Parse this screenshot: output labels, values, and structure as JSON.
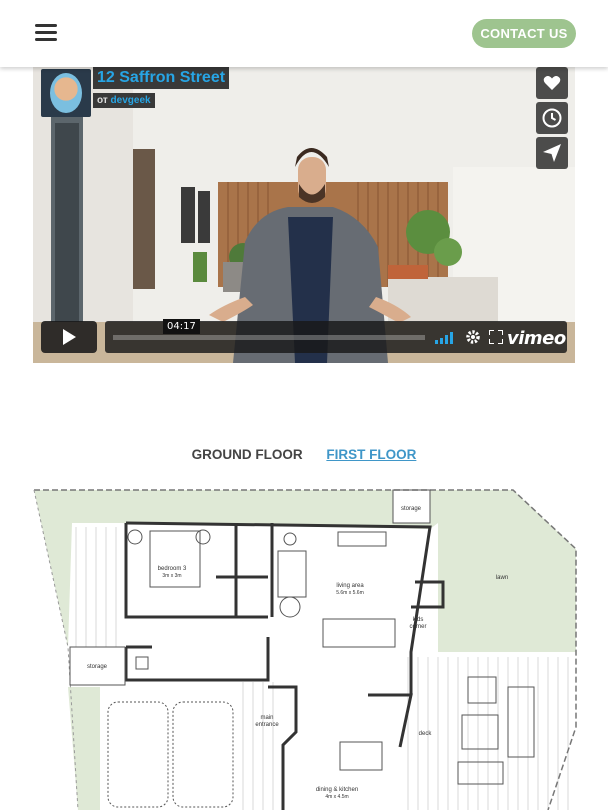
{
  "header": {
    "menu_icon": "hamburger-icon",
    "contact_label": "CONTACT US",
    "contact_color": "#9ec48f"
  },
  "video": {
    "title": "12 Saffron Street",
    "by_prefix": "от",
    "author": "devgeek",
    "timecode": "04:17",
    "brand": "vimeo",
    "side_icons": [
      "heart-icon",
      "clock-icon",
      "send-icon"
    ],
    "accent_color": "#27a5e5"
  },
  "floor_tabs": {
    "ground": "GROUND FLOOR",
    "first": "FIRST FLOOR",
    "active": "first",
    "active_color": "#3f96c8"
  },
  "floorplan": {
    "storage_top": "storage",
    "bedroom_name": "bedroom 3",
    "bedroom_size": "3m x 3m",
    "living_name": "living area",
    "living_size": "5.6m x 5.6m",
    "lawn": "lawn",
    "kids_line1": "kids",
    "kids_line2": "corner",
    "storage_left": "storage",
    "deck": "deck",
    "entrance_line1": "main",
    "entrance_line2": "entrance",
    "dining_name": "dining & kitchen",
    "dining_size": "4m x 4.5m",
    "lawn_color": "#dfe9d6"
  }
}
